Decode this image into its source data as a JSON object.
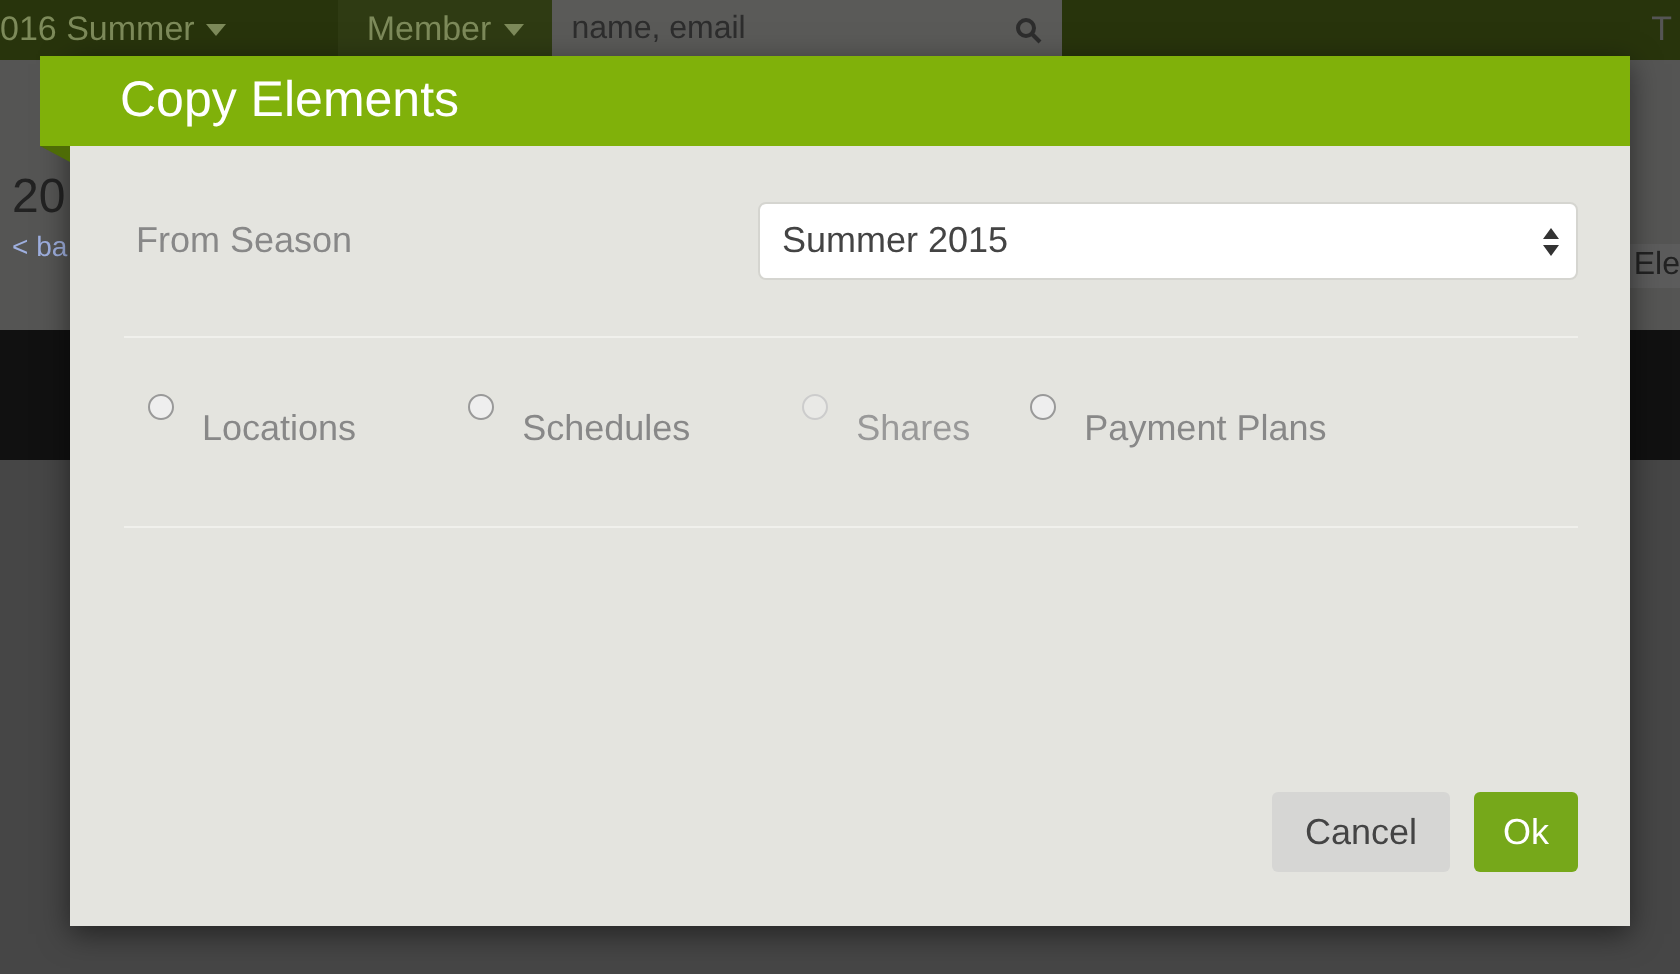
{
  "background": {
    "season_menu": "016 Summer",
    "member_menu": "Member",
    "search": {
      "placeholder": "name, email"
    },
    "top_right": "T",
    "page_title": "20",
    "back_link": "< ba",
    "right_tab": "Ele"
  },
  "dialog": {
    "title": "Copy Elements",
    "from_season": {
      "label": "From Season",
      "value": "Summer 2015"
    },
    "options": [
      {
        "label": "Locations",
        "selected": false,
        "disabled": false
      },
      {
        "label": "Schedules",
        "selected": false,
        "disabled": false
      },
      {
        "label": "Shares",
        "selected": false,
        "disabled": true
      },
      {
        "label": "Payment Plans",
        "selected": false,
        "disabled": false
      }
    ],
    "buttons": [
      {
        "label": "Cancel",
        "kind": "secondary"
      },
      {
        "label": "Ok",
        "kind": "primary"
      }
    ]
  }
}
